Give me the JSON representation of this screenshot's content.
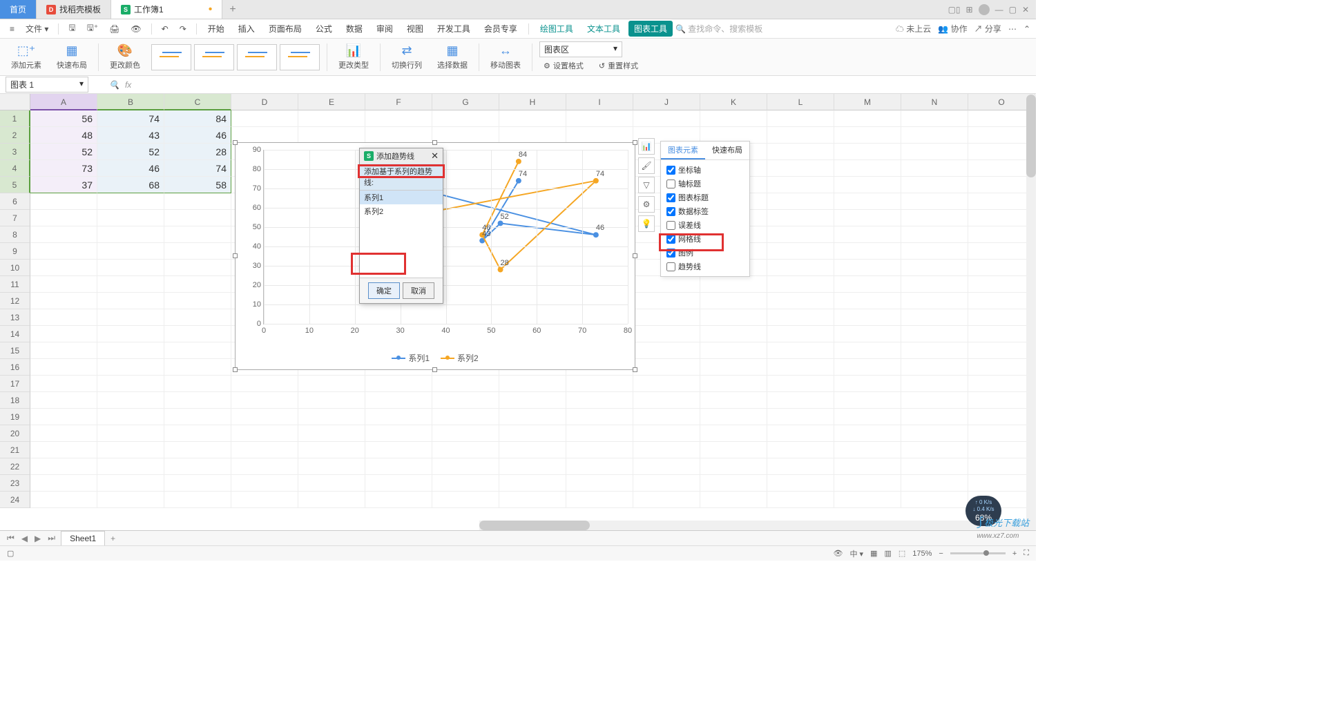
{
  "titleBar": {
    "home": "首页",
    "tab1": "找稻壳模板",
    "tab2": "工作簿1"
  },
  "menu": {
    "file": "文件",
    "items": [
      "开始",
      "插入",
      "页面布局",
      "公式",
      "数据",
      "审阅",
      "视图",
      "开发工具",
      "会员专享",
      "绘图工具",
      "文本工具",
      "图表工具"
    ],
    "search_ph": "查找命令、搜索模板",
    "cloud": "未上云",
    "coop": "协作",
    "share": "分享"
  },
  "ribbon": {
    "add_element": "添加元素",
    "quick_layout": "快速布局",
    "change_color": "更改颜色",
    "change_type": "更改类型",
    "swap_rc": "切换行列",
    "select_data": "选择数据",
    "move_chart": "移动图表",
    "area_dd": "图表区",
    "set_format": "设置格式",
    "reset_style": "重置样式"
  },
  "nameBox": "图表 1",
  "columns": [
    "A",
    "B",
    "C",
    "D",
    "E",
    "F",
    "G",
    "H",
    "I",
    "J",
    "K",
    "L",
    "M",
    "N",
    "O"
  ],
  "rows": 24,
  "data": {
    "A": [
      56,
      48,
      52,
      73,
      37
    ],
    "B": [
      74,
      43,
      52,
      46,
      68
    ],
    "C": [
      84,
      46,
      28,
      74,
      58
    ]
  },
  "chart_data": {
    "type": "scatter-line",
    "x_series": [
      56,
      48,
      52,
      73,
      37
    ],
    "series": [
      {
        "name": "系列1",
        "values": [
          74,
          43,
          52,
          46,
          68
        ],
        "labels": [
          74,
          43,
          52,
          46,
          68
        ]
      },
      {
        "name": "系列2",
        "values": [
          84,
          46,
          28,
          74,
          58
        ],
        "labels": [
          84,
          46,
          28,
          74,
          null
        ]
      }
    ],
    "xlim": [
      0,
      80
    ],
    "ylim": [
      0,
      90
    ],
    "xticks": [
      0,
      10,
      20,
      30,
      40,
      50,
      60,
      70,
      80
    ],
    "yticks": [
      0,
      10,
      20,
      30,
      40,
      50,
      60,
      70,
      80,
      90
    ],
    "legend": [
      "系列1",
      "系列2"
    ]
  },
  "dialog": {
    "title": "添加趋势线",
    "subtitle": "添加基于系列的趋势线:",
    "options": [
      "系列1",
      "系列2"
    ],
    "ok": "确定",
    "cancel": "取消"
  },
  "panel": {
    "tab1": "图表元素",
    "tab2": "快速布局",
    "items": [
      {
        "label": "坐标轴",
        "checked": true
      },
      {
        "label": "轴标题",
        "checked": false
      },
      {
        "label": "图表标题",
        "checked": true
      },
      {
        "label": "数据标签",
        "checked": true
      },
      {
        "label": "误差线",
        "checked": false
      },
      {
        "label": "网格线",
        "checked": true
      },
      {
        "label": "图例",
        "checked": true
      },
      {
        "label": "趋势线",
        "checked": false
      }
    ]
  },
  "sheetTabs": {
    "sheet1": "Sheet1"
  },
  "status": {
    "zoom": "175%",
    "perf_up": "0 K/s",
    "perf_down": "0.4 K/s",
    "perf_pct": "68%"
  },
  "watermark": "极光下载站",
  "watermark_url": "www.xz7.com"
}
